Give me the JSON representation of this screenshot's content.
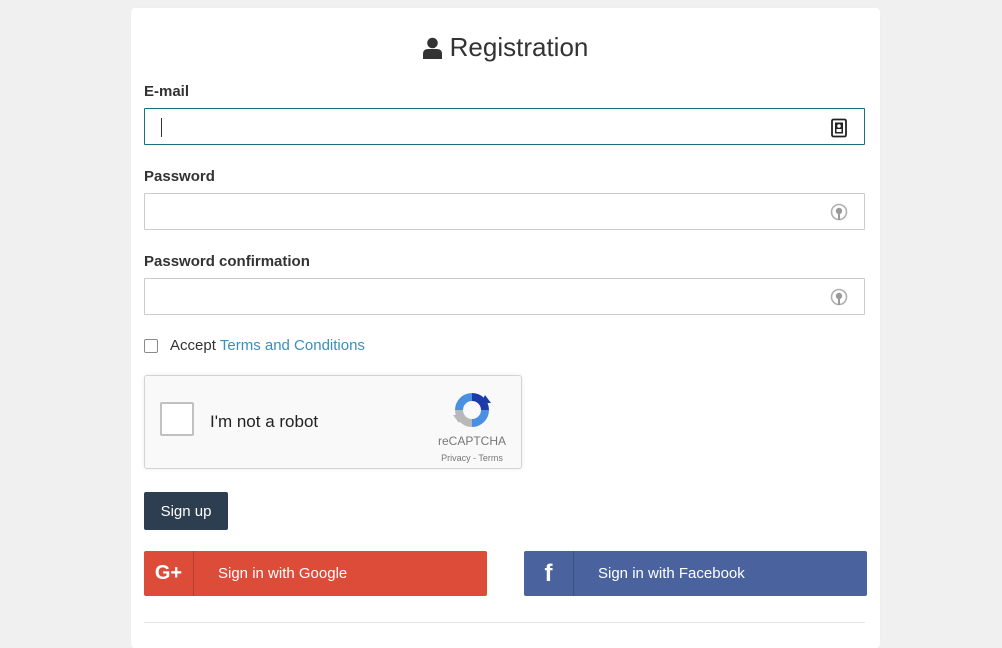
{
  "form": {
    "title": "Registration",
    "email": {
      "label": "E-mail",
      "value": "",
      "placeholder": ""
    },
    "password": {
      "label": "Password",
      "value": "",
      "placeholder": ""
    },
    "password_confirmation": {
      "label": "Password confirmation",
      "value": "",
      "placeholder": ""
    },
    "accept": {
      "text": "Accept",
      "link": "Terms and Conditions"
    },
    "recaptcha": {
      "label": "I'm not a robot",
      "brand": "reCAPTCHA",
      "links": "Privacy - Terms"
    },
    "signup_label": "Sign up",
    "google_label": "Sign in with Google",
    "google_icon_text": "G+",
    "facebook_label": "Sign in with Facebook",
    "facebook_icon_text": "f"
  },
  "colors": {
    "primary_button": "#2c3e50",
    "google": "#dd4b39",
    "facebook": "#4a639f",
    "link": "#3c8dbc",
    "focus_border": "#1e6e7a"
  },
  "icons": {
    "title": "user-icon",
    "email_field": "contact-card-icon",
    "password_field": "key-icon"
  }
}
